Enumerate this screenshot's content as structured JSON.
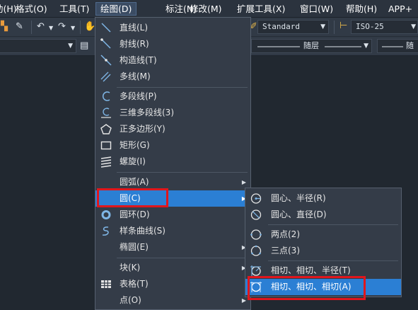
{
  "menubar": {
    "items": [
      {
        "label": "助(H)",
        "active": false
      },
      {
        "label": "格式(O)",
        "active": false
      },
      {
        "label": "工具(T)",
        "active": false
      },
      {
        "label": "绘图(D)",
        "active": true
      },
      {
        "label": "标注(N)",
        "active": false
      },
      {
        "label": "修改(M)",
        "active": false
      },
      {
        "label": "扩展工具(X)",
        "active": false
      },
      {
        "label": "窗口(W)",
        "active": false
      },
      {
        "label": "帮助(H)",
        "active": false
      },
      {
        "label": "APP+",
        "active": false
      }
    ]
  },
  "toolbar": {
    "text_style": "Standard",
    "dim_style": "ISO-25",
    "linetype": "随层",
    "linetype_right": "随"
  },
  "draw_menu": {
    "items": [
      {
        "label": "直线(L)",
        "icon": "line-icon"
      },
      {
        "label": "射线(R)",
        "icon": "ray-icon"
      },
      {
        "label": "构造线(T)",
        "icon": "xline-icon"
      },
      {
        "label": "多线(M)",
        "icon": "mline-icon"
      },
      {
        "label": "多段线(P)",
        "icon": "polyline-icon"
      },
      {
        "label": "三维多段线(3)",
        "icon": "3dpolyline-icon"
      },
      {
        "label": "正多边形(Y)",
        "icon": "polygon-icon"
      },
      {
        "label": "矩形(G)",
        "icon": "rectangle-icon"
      },
      {
        "label": "螺旋(I)",
        "icon": "helix-icon"
      },
      {
        "label": "圆弧(A)",
        "icon": ""
      },
      {
        "label": "圆(C)",
        "icon": ""
      },
      {
        "label": "圆环(D)",
        "icon": "donut-icon"
      },
      {
        "label": "样条曲线(S)",
        "icon": "spline-icon"
      },
      {
        "label": "椭圆(E)",
        "icon": ""
      },
      {
        "label": "块(K)",
        "icon": ""
      },
      {
        "label": "表格(T)",
        "icon": "table-icon"
      },
      {
        "label": "点(O)",
        "icon": ""
      }
    ]
  },
  "circle_submenu": {
    "items": [
      {
        "label": "圆心、半径(R)",
        "icon": "center-radius-icon"
      },
      {
        "label": "圆心、直径(D)",
        "icon": "center-diameter-icon"
      },
      {
        "label": "两点(2)",
        "icon": "two-point-circle-icon"
      },
      {
        "label": "三点(3)",
        "icon": "three-point-circle-icon"
      },
      {
        "label": "相切、相切、半径(T)",
        "icon": "tan-tan-radius-icon"
      },
      {
        "label": "相切、相切、相切(A)",
        "icon": "tan-tan-tan-icon"
      }
    ]
  },
  "colors": {
    "highlight": "#2b7fd4",
    "annotation_box": "#e0161c",
    "menu_bg": "#343c48",
    "app_bg": "#212830"
  }
}
